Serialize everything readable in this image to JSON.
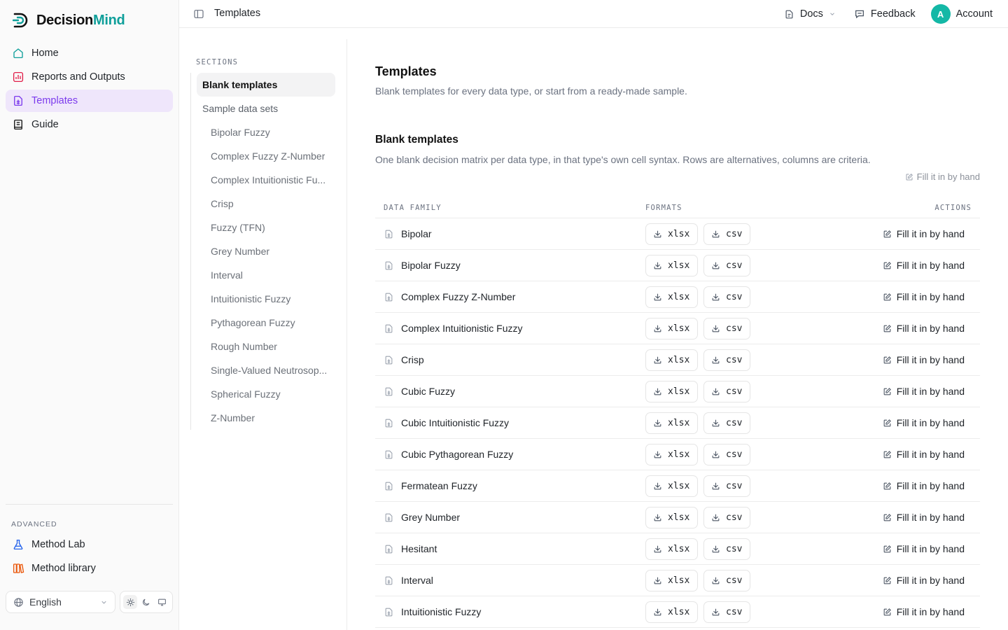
{
  "app": {
    "brand_part1": "Decision",
    "brand_part2": "Mind",
    "accent_color": "#0f9f9a",
    "active_nav_color": "#7c3aed"
  },
  "sidebar": {
    "items": [
      {
        "label": "Home",
        "icon": "home-icon"
      },
      {
        "label": "Reports and Outputs",
        "icon": "chart-icon"
      },
      {
        "label": "Templates",
        "icon": "template-icon",
        "active": true
      },
      {
        "label": "Guide",
        "icon": "book-icon"
      }
    ],
    "advanced_label": "ADVANCED",
    "advanced_items": [
      {
        "label": "Method Lab",
        "icon": "flask-icon"
      },
      {
        "label": "Method library",
        "icon": "library-icon"
      }
    ],
    "language": "English"
  },
  "topbar": {
    "breadcrumb": "Templates",
    "docs": "Docs",
    "feedback": "Feedback",
    "avatar_initial": "A",
    "account": "Account"
  },
  "sections": {
    "label": "SECTIONS",
    "blank": "Blank templates",
    "sample": "Sample data sets",
    "samples": [
      "Bipolar Fuzzy",
      "Complex Fuzzy Z-Number",
      "Complex Intuitionistic Fu...",
      "Crisp",
      "Fuzzy (TFN)",
      "Grey Number",
      "Interval",
      "Intuitionistic Fuzzy",
      "Pythagorean Fuzzy",
      "Rough Number",
      "Single-Valued Neutrosop...",
      "Spherical Fuzzy",
      "Z-Number"
    ]
  },
  "main": {
    "title": "Templates",
    "subtitle": "Blank templates for every data type, or start from a ready-made sample.",
    "blank_title": "Blank templates",
    "blank_desc": "One blank decision matrix per data type, in that type's own cell syntax. Rows are alternatives, columns are criteria.",
    "fill_hint": "Fill it in by hand",
    "headers": {
      "family": "DATA FAMILY",
      "formats": "FORMATS",
      "actions": "ACTIONS"
    },
    "xlsx_label": "xlsx",
    "csv_label": "csv",
    "action_label": "Fill it in by hand",
    "rows": [
      "Bipolar",
      "Bipolar Fuzzy",
      "Complex Fuzzy Z-Number",
      "Complex Intuitionistic Fuzzy",
      "Crisp",
      "Cubic Fuzzy",
      "Cubic Intuitionistic Fuzzy",
      "Cubic Pythagorean Fuzzy",
      "Fermatean Fuzzy",
      "Grey Number",
      "Hesitant",
      "Interval",
      "Intuitionistic Fuzzy"
    ]
  }
}
